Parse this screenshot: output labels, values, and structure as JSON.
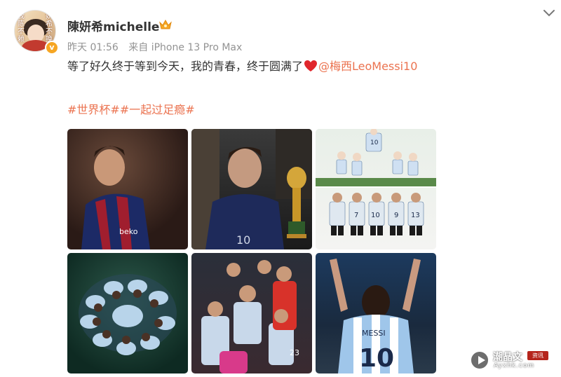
{
  "post": {
    "username": "陳妍希michelle",
    "avatar_caption_left": "我陈不赖",
    "avatar_caption_right": "妍希不换",
    "meta": {
      "time": "昨天 01:56",
      "source": "来自 iPhone 13 Pro Max"
    },
    "text_before": "等了好久终于等到今天，我的青春，终于圆满了",
    "mention": "@梅西LeoMessi10",
    "topics": [
      "#世界杯#",
      "#一起过足瘾#"
    ]
  },
  "images": [
    {
      "alt": "Messi in Barcelona jersey",
      "labels": [
        "beko"
      ]
    },
    {
      "alt": "Messi in Argentina navy jersey near World Cup trophy",
      "labels": [
        "10"
      ]
    },
    {
      "alt": "Argentina players cartoon illustration",
      "labels": [
        "10",
        "7",
        "10",
        "9",
        "13"
      ]
    },
    {
      "alt": "Argentina team huddle",
      "labels": []
    },
    {
      "alt": "Argentina team celebrating",
      "labels": [
        "23"
      ]
    },
    {
      "alt": "Messi from behind with arms raised",
      "labels": [
        "MESSI",
        "10"
      ]
    }
  ],
  "watermark": {
    "main": "潮晶文",
    "tag": "资讯",
    "sub": "Ayxhk.com"
  },
  "colors": {
    "accent": "#eb7350",
    "verified": "#f6a623",
    "meta": "#939393",
    "heart": "#e0262c"
  },
  "icons": {
    "crown": "crown-icon",
    "verified": "verified-badge-icon",
    "chevron": "chevron-down-icon",
    "heart": "heart-emoji-icon",
    "play": "play-icon"
  }
}
